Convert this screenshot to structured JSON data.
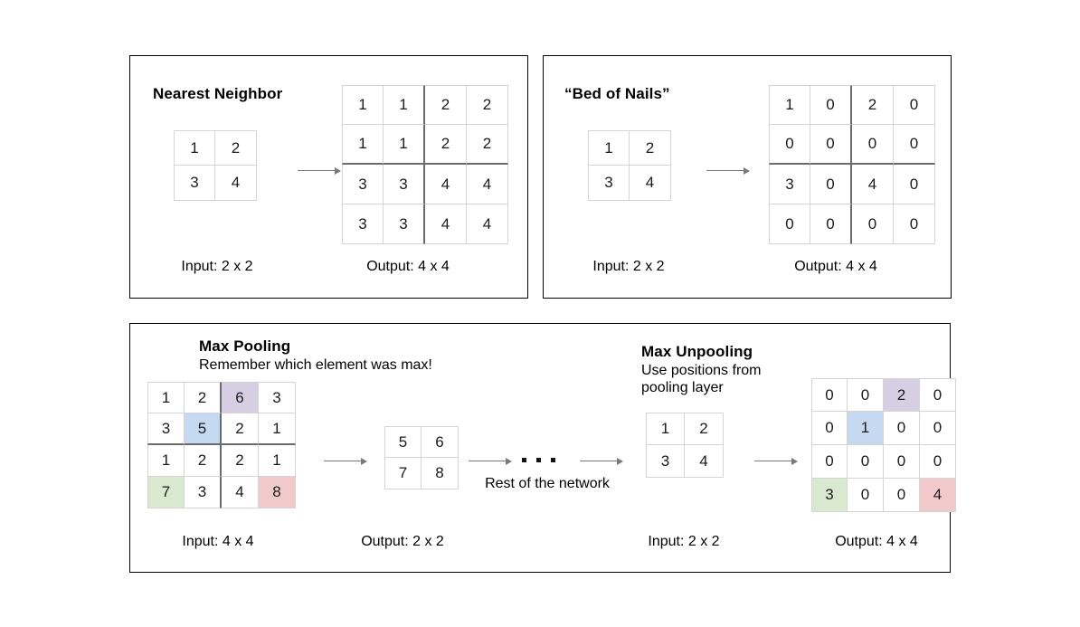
{
  "panels": {
    "nearest_neighbor": {
      "title": "Nearest Neighbor",
      "input_caption": "Input: 2 x 2",
      "output_caption": "Output: 4 x 4",
      "input_grid": [
        [
          "1",
          "2"
        ],
        [
          "3",
          "4"
        ]
      ],
      "output_grid": [
        [
          "1",
          "1",
          "2",
          "2"
        ],
        [
          "1",
          "1",
          "2",
          "2"
        ],
        [
          "3",
          "3",
          "4",
          "4"
        ],
        [
          "3",
          "3",
          "4",
          "4"
        ]
      ]
    },
    "bed_of_nails": {
      "title": "“Bed of Nails”",
      "input_caption": "Input: 2 x 2",
      "output_caption": "Output: 4 x 4",
      "input_grid": [
        [
          "1",
          "2"
        ],
        [
          "3",
          "4"
        ]
      ],
      "output_grid": [
        [
          "1",
          "0",
          "2",
          "0"
        ],
        [
          "0",
          "0",
          "0",
          "0"
        ],
        [
          "3",
          "0",
          "4",
          "0"
        ],
        [
          "0",
          "0",
          "0",
          "0"
        ]
      ]
    },
    "max_pooling": {
      "title": "Max Pooling",
      "subtitle": "Remember which element was max!",
      "input_caption": "Input: 4 x 4",
      "output_caption": "Output: 2 x 2",
      "input_grid": [
        [
          "1",
          "2",
          "6",
          "3"
        ],
        [
          "3",
          "5",
          "2",
          "1"
        ],
        [
          "1",
          "2",
          "2",
          "1"
        ],
        [
          "7",
          "3",
          "4",
          "8"
        ]
      ],
      "output_grid": [
        [
          "5",
          "6"
        ],
        [
          "7",
          "8"
        ]
      ]
    },
    "rest_of_network": {
      "label": "Rest of the network",
      "dots": 3
    },
    "max_unpooling": {
      "title": "Max Unpooling",
      "subtitle_line1": "Use positions from",
      "subtitle_line2": "pooling layer",
      "input_caption": "Input: 2 x 2",
      "output_caption": "Output: 4 x 4",
      "input_grid": [
        [
          "1",
          "2"
        ],
        [
          "3",
          "4"
        ]
      ],
      "output_grid": [
        [
          "0",
          "0",
          "2",
          "0"
        ],
        [
          "0",
          "1",
          "0",
          "0"
        ],
        [
          "0",
          "0",
          "0",
          "0"
        ],
        [
          "3",
          "0",
          "0",
          "4"
        ]
      ]
    }
  },
  "colors": {
    "highlight_purple": "#d6cee2",
    "highlight_blue": "#c5daf0",
    "highlight_green": "#d8e9d0",
    "highlight_red": "#f1c9cb",
    "cell_border": "#d4d4d4",
    "divider": "#6b6b6b",
    "panel_border": "#000000",
    "arrow": "#7a7a7a",
    "text": "#1b1b1b"
  }
}
